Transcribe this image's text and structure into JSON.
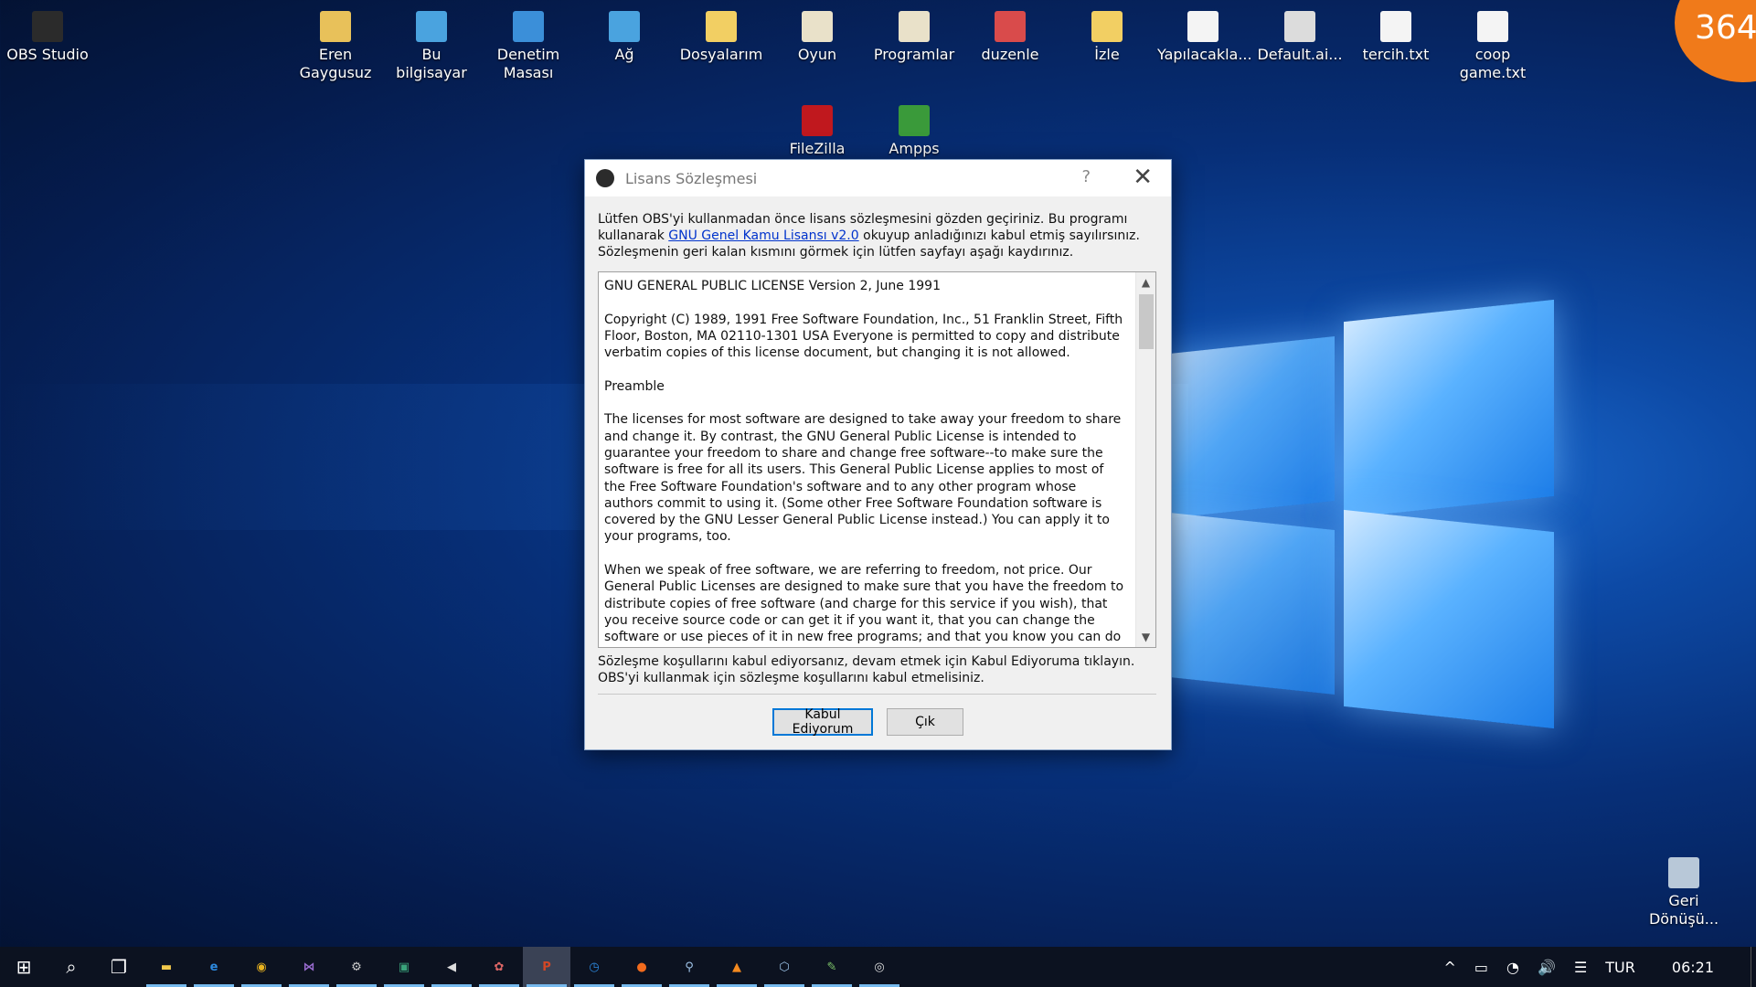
{
  "desktop": {
    "icons": [
      {
        "label": "OBS Studio",
        "icon": "obs-icon",
        "color": "#2b2b2b"
      },
      {
        "label": "Eren Gaygusuz",
        "icon": "user-folder-icon",
        "color": "#e8c15a"
      },
      {
        "label": "Bu bilgisayar",
        "icon": "computer-icon",
        "color": "#4aa3df"
      },
      {
        "label": "Denetim Masası",
        "icon": "control-panel-icon",
        "color": "#3b8fd9"
      },
      {
        "label": "Ağ",
        "icon": "network-icon",
        "color": "#4aa3df"
      },
      {
        "label": "Dosyalarım",
        "icon": "folder-icon",
        "color": "#f2cf63"
      },
      {
        "label": "Oyun",
        "icon": "archive-icon",
        "color": "#e9e1c9"
      },
      {
        "label": "Programlar",
        "icon": "archive-icon",
        "color": "#e9e1c9"
      },
      {
        "label": "duzenle",
        "icon": "archive-red-icon",
        "color": "#d94b4b"
      },
      {
        "label": "İzle",
        "icon": "folder-icon",
        "color": "#f2cf63"
      },
      {
        "label": "Yapılacakla...",
        "icon": "text-file-icon",
        "color": "#f4f4f4"
      },
      {
        "label": "Default.ai...",
        "icon": "image-file-icon",
        "color": "#dcdcdc"
      },
      {
        "label": "tercih.txt",
        "icon": "text-file-icon",
        "color": "#f4f4f4"
      },
      {
        "label": "coop game.txt",
        "icon": "text-file-icon",
        "color": "#f4f4f4"
      },
      {
        "label": "FileZilla",
        "icon": "filezilla-icon",
        "color": "#c0181e"
      },
      {
        "label": "Ampps",
        "icon": "ampps-icon",
        "color": "#3a9a3a"
      },
      {
        "label": "Geri Dönüşü...",
        "icon": "recycle-bin-icon",
        "color": "#b8c8d8"
      }
    ],
    "badge": "364"
  },
  "dialog": {
    "title": "Lisans Sözleşmesi",
    "help": "?",
    "close": "✕",
    "intro_before": "Lütfen OBS'yi kullanmadan önce lisans sözleşmesini gözden geçiriniz. Bu programı kullanarak ",
    "intro_link": "GNU Genel Kamu Lisansı v2.0",
    "intro_after": " okuyup anladığınızı kabul etmiş sayılırsınız. Sözleşmenin geri kalan kısmını görmek için lütfen sayfayı aşağı kaydırınız.",
    "license_paragraphs": [
      "GNU GENERAL PUBLIC LICENSE Version 2, June 1991",
      "Copyright (C) 1989, 1991 Free Software Foundation, Inc., 51 Franklin Street, Fifth Floor, Boston, MA 02110-1301 USA Everyone is permitted to copy and distribute verbatim copies of this license document, but changing it is not allowed.",
      "Preamble",
      "The licenses for most software are designed to take away your freedom to share and change it. By contrast, the GNU General Public License is intended to guarantee your freedom to share and change free software--to make sure the software is free for all its users. This General Public License applies to most of the Free Software Foundation's software and to any other program whose authors commit to using it. (Some other Free Software Foundation software is covered by the GNU Lesser General Public License instead.) You can apply it to your programs, too.",
      "When we speak of free software, we are referring to freedom, not price. Our General Public Licenses are designed to make sure that you have the freedom to distribute copies of free software (and charge for this service if you wish), that you receive source code or can get it if you want it, that you can change the software or use pieces of it in new free programs; and that you know you can do these things."
    ],
    "footer": "Sözleşme koşullarını kabul ediyorsanız, devam etmek için Kabul Ediyoruma tıklayın. OBS'yi kullanmak için sözleşme koşullarını kabul etmelisiniz.",
    "accept_label": "Kabul Ediyorum",
    "exit_label": "Çık"
  },
  "taskbar": {
    "apps": [
      {
        "icon": "start-icon",
        "glyph": "⊞",
        "color": "#ffffff"
      },
      {
        "icon": "search-icon",
        "glyph": "⌕",
        "color": "#ffffff"
      },
      {
        "icon": "task-view-icon",
        "glyph": "❐",
        "color": "#ffffff"
      },
      {
        "icon": "file-explorer-icon",
        "glyph": "▬",
        "color": "#f2c94c"
      },
      {
        "icon": "edge-icon",
        "glyph": "e",
        "color": "#2d8ae0"
      },
      {
        "icon": "chrome-icon",
        "glyph": "◉",
        "color": "#e8b21f"
      },
      {
        "icon": "visual-studio-icon",
        "glyph": "⋈",
        "color": "#9a6cd1"
      },
      {
        "icon": "sql-icon",
        "glyph": "⚙",
        "color": "#cccccc"
      },
      {
        "icon": "sublime-icon",
        "glyph": "▣",
        "color": "#3aa37b"
      },
      {
        "icon": "media-icon",
        "glyph": "◀",
        "color": "#dddddd"
      },
      {
        "icon": "app-icon",
        "glyph": "✿",
        "color": "#d66"
      },
      {
        "icon": "powerpoint-icon",
        "glyph": "P",
        "color": "#d24726"
      },
      {
        "icon": "clock-app-icon",
        "glyph": "◷",
        "color": "#2d8ae0"
      },
      {
        "icon": "origin-icon",
        "glyph": "●",
        "color": "#f26b1d"
      },
      {
        "icon": "steam-icon",
        "glyph": "⚲",
        "color": "#9fc3e8"
      },
      {
        "icon": "vlc-icon",
        "glyph": "▲",
        "color": "#f58a1f"
      },
      {
        "icon": "virtualbox-icon",
        "glyph": "⬡",
        "color": "#9cc3e8"
      },
      {
        "icon": "paint-icon",
        "glyph": "✎",
        "color": "#7ec46a"
      },
      {
        "icon": "obs-taskbar-icon",
        "glyph": "◎",
        "color": "#dddddd"
      }
    ],
    "tray": {
      "chevron": "^",
      "battery": "▭",
      "wifi": "◔",
      "volume": "🔊",
      "notifications": "☰",
      "language": "TUR",
      "time": "06:21"
    }
  }
}
